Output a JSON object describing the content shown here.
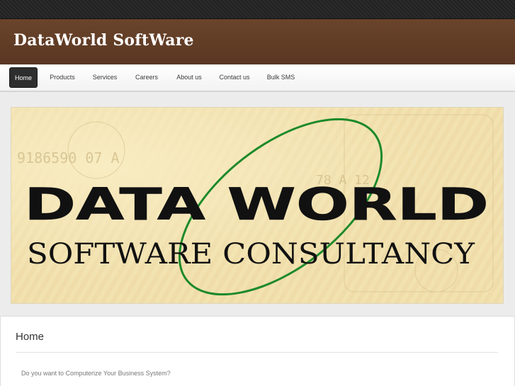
{
  "site": {
    "title": "DataWorld SoftWare"
  },
  "nav": {
    "items": [
      {
        "label": "Home",
        "active": true
      },
      {
        "label": "Products",
        "active": false
      },
      {
        "label": "Services",
        "active": false
      },
      {
        "label": "Careers",
        "active": false
      },
      {
        "label": "About us",
        "active": false
      },
      {
        "label": "Contact us",
        "active": false
      },
      {
        "label": "Bulk SMS",
        "active": false
      }
    ]
  },
  "banner": {
    "line1": "DATA WORLD",
    "line2": "SOFTWARE CONSULTANCY",
    "bg_number_left": "9186590 07 A",
    "bg_number_right": "78 A 12"
  },
  "content": {
    "heading": "Home",
    "paragraphs": [
      "Do you want to Computerize Your Business System?"
    ]
  },
  "colors": {
    "header_brown": "#5f3c25",
    "nav_active_bg": "#2e2e2e",
    "banner_ellipse": "#1d8a2a",
    "banner_text": "#111111"
  }
}
